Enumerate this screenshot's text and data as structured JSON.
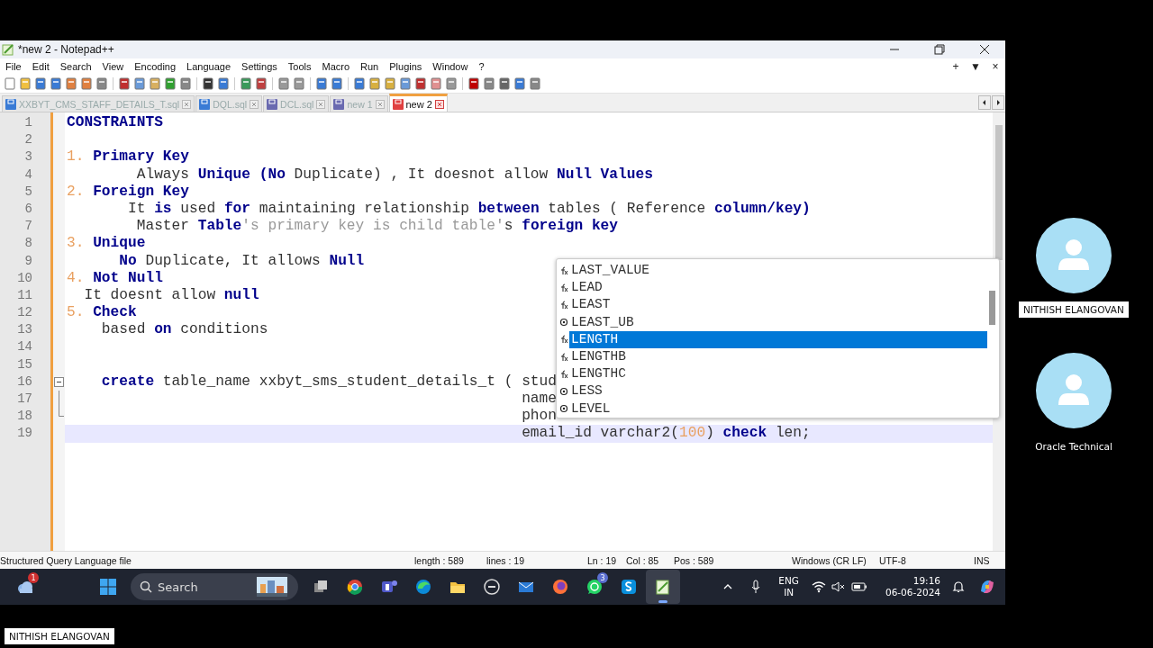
{
  "window": {
    "title": "*new 2 - Notepad++"
  },
  "menu": [
    "File",
    "Edit",
    "Search",
    "View",
    "Encoding",
    "Language",
    "Settings",
    "Tools",
    "Macro",
    "Run",
    "Plugins",
    "Window",
    "?"
  ],
  "menu_right": [
    "+",
    "▼",
    "×"
  ],
  "tabs": [
    {
      "label": "XXBYT_CMS_STAFF_DETAILS_T.sql",
      "color": "#3a7bd5",
      "selected": false
    },
    {
      "label": "DQL.sql",
      "color": "#3a7bd5",
      "selected": false
    },
    {
      "label": "DCL.sql",
      "color": "#6a6ab0",
      "selected": false
    },
    {
      "label": "new 1",
      "color": "#6a6ab0",
      "selected": false
    },
    {
      "label": "new 2",
      "color": "#e04040",
      "selected": true
    }
  ],
  "editor": {
    "lines": [
      {
        "number": "1",
        "kind": "text",
        "current": false,
        "tokens": [
          {
            "kind": "keyword",
            "text": "CONSTRAINTS"
          }
        ]
      },
      {
        "number": "2",
        "kind": "text",
        "current": false
      },
      {
        "number": "3",
        "kind": "text",
        "current": false,
        "tokens": [
          {
            "kind": "number",
            "text": "1. "
          },
          {
            "kind": "keyword",
            "text": "Primary Key"
          }
        ]
      },
      {
        "number": "4",
        "kind": "text",
        "current": false,
        "tokens": [
          {
            "kind": "plain",
            "text": "        Always "
          },
          {
            "kind": "keyword",
            "text": "Unique (No"
          },
          {
            "kind": "plain",
            "text": " Duplicate) , It doesnot allow "
          },
          {
            "kind": "keyword",
            "text": "Null Values"
          }
        ]
      },
      {
        "number": "5",
        "kind": "text",
        "current": false,
        "tokens": [
          {
            "kind": "number",
            "text": "2. "
          },
          {
            "kind": "keyword",
            "text": "Foreign Key"
          }
        ]
      },
      {
        "number": "6",
        "kind": "text",
        "current": false,
        "tokens": [
          {
            "kind": "plain",
            "text": "       It "
          },
          {
            "kind": "keyword",
            "text": "is"
          },
          {
            "kind": "plain",
            "text": " used "
          },
          {
            "kind": "keyword",
            "text": "for"
          },
          {
            "kind": "plain",
            "text": " maintaining relationship "
          },
          {
            "kind": "keyword",
            "text": "between"
          },
          {
            "kind": "plain",
            "text": " tables ( Reference "
          },
          {
            "kind": "keyword",
            "text": "column/key)"
          }
        ]
      },
      {
        "number": "7",
        "kind": "text",
        "current": false,
        "tokens": [
          {
            "kind": "plain",
            "text": "        Master "
          },
          {
            "kind": "keyword",
            "text": "Table"
          },
          {
            "kind": "string",
            "text": "'s primary key is child table'"
          },
          {
            "kind": "plain",
            "text": "s "
          },
          {
            "kind": "keyword",
            "text": "foreign key"
          }
        ]
      },
      {
        "number": "8",
        "kind": "text",
        "current": false,
        "tokens": [
          {
            "kind": "number",
            "text": "3. "
          },
          {
            "kind": "keyword",
            "text": "Unique"
          }
        ]
      },
      {
        "number": "9",
        "kind": "text",
        "current": false,
        "tokens": [
          {
            "kind": "keyword",
            "text": "      No"
          },
          {
            "kind": "plain",
            "text": " Duplicate, It allows "
          },
          {
            "kind": "keyword",
            "text": "Null"
          }
        ]
      },
      {
        "number": "10",
        "kind": "text",
        "current": false,
        "tokens": [
          {
            "kind": "number",
            "text": "4. "
          },
          {
            "kind": "keyword",
            "text": "Not Null"
          }
        ]
      },
      {
        "number": "11",
        "kind": "text",
        "current": false,
        "tokens": [
          {
            "kind": "plain",
            "text": "  It doesnt allow "
          },
          {
            "kind": "keyword",
            "text": "null"
          }
        ]
      },
      {
        "number": "12",
        "kind": "text",
        "current": false,
        "tokens": [
          {
            "kind": "number",
            "text": "5. "
          },
          {
            "kind": "keyword",
            "text": "Check"
          }
        ]
      },
      {
        "number": "13",
        "kind": "text",
        "current": false,
        "tokens": [
          {
            "kind": "plain",
            "text": "    based "
          },
          {
            "kind": "keyword",
            "text": "on"
          },
          {
            "kind": "plain",
            "text": " conditions"
          }
        ]
      },
      {
        "number": "14",
        "kind": "text",
        "current": false
      },
      {
        "number": "15",
        "kind": "text",
        "current": false
      },
      {
        "number": "16",
        "kind": "fold-start",
        "current": false,
        "tokens": [
          {
            "kind": "keyword",
            "text": "    create"
          },
          {
            "kind": "plain",
            "text": " table_name xxbyt_sms_student_details_t ( stud"
          }
        ]
      },
      {
        "number": "17",
        "kind": "fold-body",
        "current": false,
        "tokens": [
          {
            "kind": "plain",
            "text": "                                                    name"
          }
        ]
      },
      {
        "number": "18",
        "kind": "fold-end",
        "current": false,
        "tokens": [
          {
            "kind": "plain",
            "text": "                                                    phon"
          }
        ]
      },
      {
        "number": "19",
        "kind": "text",
        "current": true,
        "tokens": [
          {
            "kind": "plain",
            "text": "                                                    email_id varchar2("
          },
          {
            "kind": "number",
            "text": "100"
          },
          {
            "kind": "plain",
            "text": ") "
          },
          {
            "kind": "keyword",
            "text": "check"
          },
          {
            "kind": "plain",
            "text": " len;"
          }
        ]
      }
    ]
  },
  "autocomplete": {
    "items": [
      {
        "label": "LAST_VALUE",
        "kind": "function",
        "selected": false
      },
      {
        "label": "LEAD",
        "kind": "function",
        "selected": false
      },
      {
        "label": "LEAST",
        "kind": "function",
        "selected": false
      },
      {
        "label": "LEAST_UB",
        "kind": "other",
        "selected": false
      },
      {
        "label": "LENGTH",
        "kind": "function",
        "selected": true
      },
      {
        "label": "LENGTHB",
        "kind": "function",
        "selected": false
      },
      {
        "label": "LENGTHC",
        "kind": "function",
        "selected": false
      },
      {
        "label": "LESS",
        "kind": "other",
        "selected": false
      },
      {
        "label": "LEVEL",
        "kind": "other",
        "selected": false
      }
    ]
  },
  "status_bar": {
    "file_type": "Structured Query Language file",
    "length": "length : 589",
    "lines": "lines : 19",
    "ln": "Ln : 19",
    "col": "Col : 85",
    "pos": "Pos : 589",
    "eol": "Windows (CR LF)",
    "encoding": "UTF-8",
    "mode": "INS"
  },
  "taskbar": {
    "weather_badge": "1",
    "search": {
      "placeholder": "Search"
    },
    "apps": [
      {
        "kind": "task-view",
        "active": false
      },
      {
        "kind": "chrome",
        "active": false
      },
      {
        "kind": "teams",
        "active": false
      },
      {
        "kind": "edge",
        "active": false
      },
      {
        "kind": "folder",
        "active": false
      },
      {
        "kind": "dell",
        "active": false
      },
      {
        "kind": "mail",
        "active": false
      },
      {
        "kind": "firefox",
        "active": false
      },
      {
        "kind": "whatsapp",
        "active": false,
        "badge": "3"
      },
      {
        "kind": "skype",
        "active": false
      },
      {
        "kind": "notepad",
        "active": true
      }
    ],
    "language": [
      "ENG",
      "IN"
    ],
    "time": "19:16",
    "date": "06-06-2024"
  },
  "participants": [
    {
      "name": "NITHISH ELANGOVAN",
      "kind": "boxed"
    },
    {
      "name": "Oracle Technical",
      "kind": "plain"
    }
  ],
  "presenter": "NITHISH ELANGOVAN"
}
